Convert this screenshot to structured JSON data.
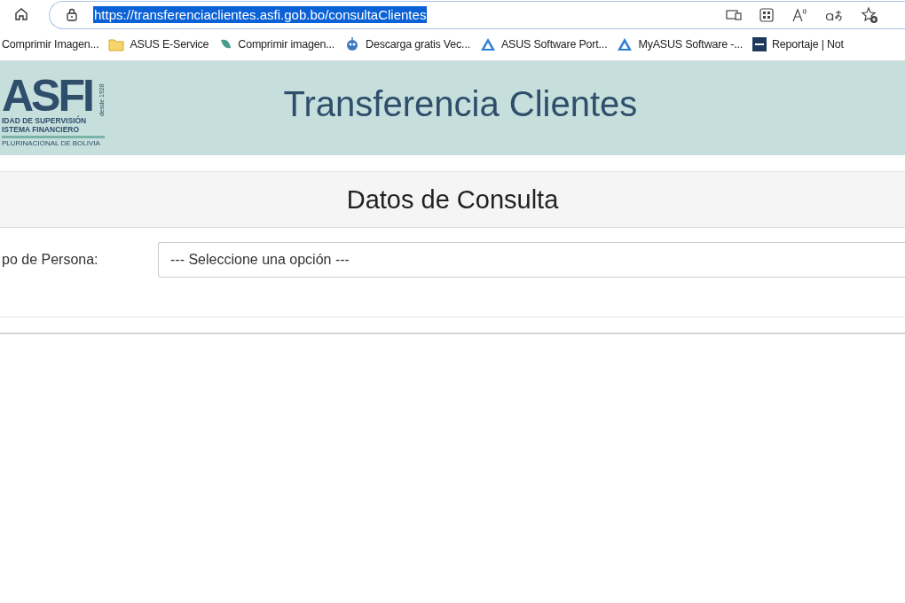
{
  "browser": {
    "url": "https://transferenciaclientes.asfi.gob.bo/consultaClientes",
    "url_selected": true,
    "bookmarks": [
      {
        "label": "Comprimir Imagen..."
      },
      {
        "label": "ASUS E-Service"
      },
      {
        "label": "Comprimir imagen..."
      },
      {
        "label": "Descarga gratis Vec..."
      },
      {
        "label": "ASUS Software Port..."
      },
      {
        "label": "MyASUS Software -..."
      },
      {
        "label": "Reportaje | Not"
      }
    ]
  },
  "header": {
    "logo": {
      "mark": "ASFI",
      "since": "desde 1928",
      "line_1": "IDAD DE SUPERVISIÓN",
      "line_2": "ISTEMA FINANCIERO",
      "line_3": "PLURINACIONAL DE BOLIVIA"
    },
    "title": "Transferencia Clientes"
  },
  "panel": {
    "heading": "Datos de Consulta",
    "fields": [
      {
        "label": "po de Persona:",
        "value": "--- Seleccione una opción ---"
      }
    ]
  }
}
